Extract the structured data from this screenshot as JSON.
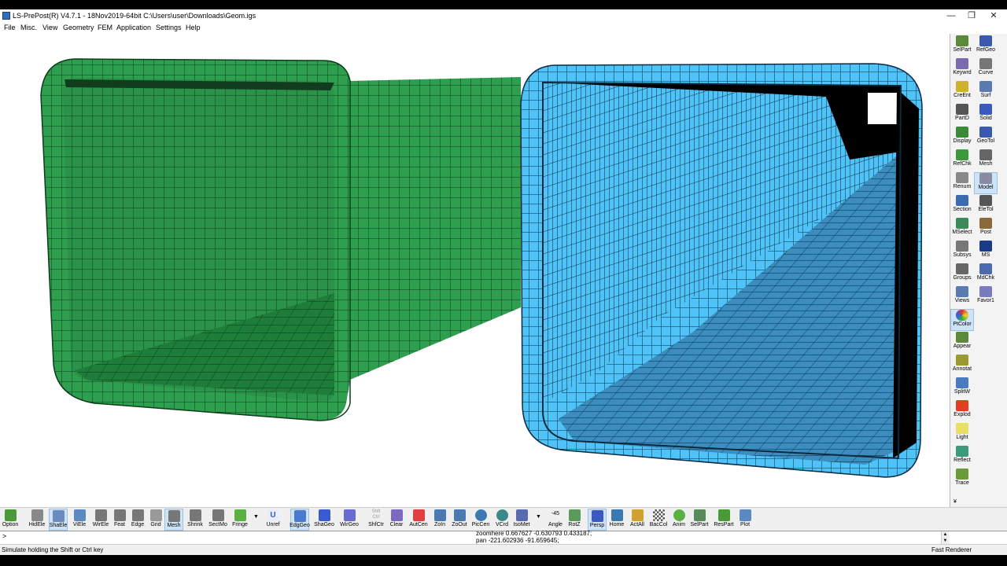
{
  "window": {
    "title": "LS-PrePost(R) V4.7.1 - 18Nov2019-64bit C:\\Users\\user\\Downloads\\Geom.igs",
    "minimize": "—",
    "maximize": "❐",
    "close": "✕"
  },
  "menu": [
    "File",
    "Misc.",
    "View",
    "Geometry",
    "FEM",
    "Application",
    "Settings",
    "Help"
  ],
  "viewport": {
    "parts": [
      {
        "name": "green-square-tube",
        "color": "#2e9e4f"
      },
      {
        "name": "blue-square-tube",
        "color": "#4fc3f7"
      }
    ]
  },
  "right_panel": {
    "col1": [
      {
        "label": "SelPart",
        "icon": "selpart-icon",
        "color": "#5a8a3a"
      },
      {
        "label": "Keywrd",
        "icon": "keyword-icon",
        "color": "#7a6ab0"
      },
      {
        "label": "CreEnt",
        "icon": "create-entity-icon",
        "color": "#d0b030"
      },
      {
        "label": "PartD",
        "icon": "part-data-icon",
        "color": "#555555"
      },
      {
        "label": "Display",
        "icon": "display-icon",
        "color": "#3a8a3a"
      },
      {
        "label": "RefChk",
        "icon": "refchk-icon",
        "color": "#3a9a3a"
      },
      {
        "label": "Renum",
        "icon": "renum-icon",
        "color": "#888888"
      },
      {
        "label": "Section",
        "icon": "section-icon",
        "color": "#3a6ab0"
      },
      {
        "label": "MSelect",
        "icon": "mselect-icon",
        "color": "#3a8a5a"
      },
      {
        "label": "Subsys",
        "icon": "subsys-icon",
        "color": "#777777"
      },
      {
        "label": "Groups",
        "icon": "groups-icon",
        "color": "#666666"
      },
      {
        "label": "Views",
        "icon": "views-icon",
        "color": "#5a7ab0"
      },
      {
        "label": "PtColor",
        "icon": "part-color-icon",
        "color": "#e03030",
        "active": true
      },
      {
        "label": "Appear",
        "icon": "appear-icon",
        "color": "#5a8a3a"
      },
      {
        "label": "Annotat",
        "icon": "annotate-icon",
        "color": "#9a9a30"
      },
      {
        "label": "SplitW",
        "icon": "split-window-icon",
        "color": "#4a7ac0"
      },
      {
        "label": "Explod",
        "icon": "explode-icon",
        "color": "#e04020"
      },
      {
        "label": "Light",
        "icon": "light-icon",
        "color": "#e8e060"
      },
      {
        "label": "Reflect",
        "icon": "reflect-icon",
        "color": "#3a9a7a"
      },
      {
        "label": "Trace",
        "icon": "trace-icon",
        "color": "#6a9a3a"
      }
    ],
    "col2": [
      {
        "label": "RefGeo",
        "icon": "refgeo-icon",
        "color": "#3a5ab0"
      },
      {
        "label": "Curve",
        "icon": "curve-icon",
        "color": "#777777"
      },
      {
        "label": "Surf",
        "icon": "surface-icon",
        "color": "#5a7ab0"
      },
      {
        "label": "Solid",
        "icon": "solid-icon",
        "color": "#3a5ac0"
      },
      {
        "label": "GeoTol",
        "icon": "geotol-icon",
        "color": "#3a5ab0"
      },
      {
        "label": "Mesh",
        "icon": "mesh-icon",
        "color": "#666666"
      },
      {
        "label": "Model",
        "icon": "model-icon",
        "color": "#8a8aa0",
        "active": true
      },
      {
        "label": "EleTol",
        "icon": "eletol-icon",
        "color": "#555555"
      },
      {
        "label": "Post",
        "icon": "post-icon",
        "color": "#8a6a3a"
      },
      {
        "label": "MS",
        "icon": "ms-icon",
        "color": "#1a3a8a"
      },
      {
        "label": "MdChk",
        "icon": "model-check-icon",
        "color": "#4a6ab0"
      },
      {
        "label": "Favor1",
        "icon": "favorite-icon",
        "color": "#7a7ac0"
      }
    ],
    "collapse": "¥"
  },
  "bottom_toolbar": [
    {
      "label": "Option",
      "icon": "option-icon",
      "color": "#4a9a3a"
    },
    {
      "label": "HidEle",
      "icon": "hidden-element-icon",
      "color": "#888888"
    },
    {
      "label": "ShaEle",
      "icon": "shaded-element-icon",
      "color": "#6a8ac0",
      "active": true
    },
    {
      "label": "ViEle",
      "icon": "visible-element-icon",
      "color": "#5a8ac0"
    },
    {
      "label": "WirEle",
      "icon": "wire-element-icon",
      "color": "#777777"
    },
    {
      "label": "Feat",
      "icon": "feature-icon",
      "color": "#777777"
    },
    {
      "label": "Edge",
      "icon": "edge-icon",
      "color": "#777777"
    },
    {
      "label": "Grid",
      "icon": "grid-icon",
      "color": "#999999"
    },
    {
      "label": "Mesh",
      "icon": "mesh-toggle-icon",
      "color": "#777777",
      "active": true
    },
    {
      "label": "Shrink",
      "icon": "shrink-icon",
      "color": "#777777"
    },
    {
      "label": "SectMo",
      "icon": "section-mode-icon",
      "color": "#777777"
    },
    {
      "label": "Fringe",
      "icon": "fringe-icon",
      "color": "#5ab040"
    },
    {
      "label": "Unref",
      "icon": "unref-icon",
      "color": "#5a7ac0",
      "text": "U"
    },
    {
      "label": "EdgGeo",
      "icon": "edge-geometry-icon",
      "color": "#4a7ad0",
      "active": true
    },
    {
      "label": "ShaGeo",
      "icon": "shaded-geometry-icon",
      "color": "#3a5ad0"
    },
    {
      "label": "WirGeo",
      "icon": "wire-geometry-icon",
      "color": "#6a6ad0"
    },
    {
      "label": "ShfCtr",
      "icon": "shift-ctrl-icon",
      "color": "#cccccc",
      "text": "Shft Ctrl"
    },
    {
      "label": "Clear",
      "icon": "clear-icon",
      "color": "#7a6ac0"
    },
    {
      "label": "AutCen",
      "icon": "auto-center-icon",
      "color": "#e04040"
    },
    {
      "label": "ZoIn",
      "icon": "zoom-in-icon",
      "color": "#4a7ab0"
    },
    {
      "label": "ZoOut",
      "icon": "zoom-out-icon",
      "color": "#4a7ab0"
    },
    {
      "label": "PicCen",
      "icon": "pick-center-icon",
      "color": "#3a7ab0"
    },
    {
      "label": "VCrd",
      "icon": "view-coord-icon",
      "color": "#3a8a8a"
    },
    {
      "label": "IsoMet",
      "icon": "isometric-icon",
      "color": "#5a6ab0"
    },
    {
      "label": "Angle",
      "icon": "angle-icon",
      "color": "#dddddd",
      "text": "-45"
    },
    {
      "label": "RotZ",
      "icon": "rotate-z-icon",
      "color": "#5a9a5a"
    },
    {
      "label": "Persp",
      "icon": "perspective-icon",
      "color": "#3a5ac0",
      "active": true
    },
    {
      "label": "Home",
      "icon": "home-icon",
      "color": "#3a7ab0"
    },
    {
      "label": "ActAll",
      "icon": "activate-all-icon",
      "color": "#d0a030"
    },
    {
      "label": "BacCol",
      "icon": "background-color-icon",
      "color": "#999999"
    },
    {
      "label": "Anim",
      "icon": "animate-icon",
      "color": "#5ab040"
    },
    {
      "label": "SelPart",
      "icon": "select-part-icon",
      "color": "#5a8a5a"
    },
    {
      "label": "ResPart",
      "icon": "reset-part-icon",
      "color": "#4a9a3a"
    },
    {
      "label": "Plot",
      "icon": "plot-icon",
      "color": "#5a8ac0"
    }
  ],
  "command": {
    "prompt": ">",
    "log_line1": "zoomhere 0.667627 -0.630793 0.433187;",
    "log_line2": "pan -221.602936 -91.659645;",
    "scroll_up": "▲",
    "scroll_down": "▼"
  },
  "status": {
    "message": "Simulate holding the Shift or Ctrl key",
    "renderer": "Fast Renderer"
  }
}
